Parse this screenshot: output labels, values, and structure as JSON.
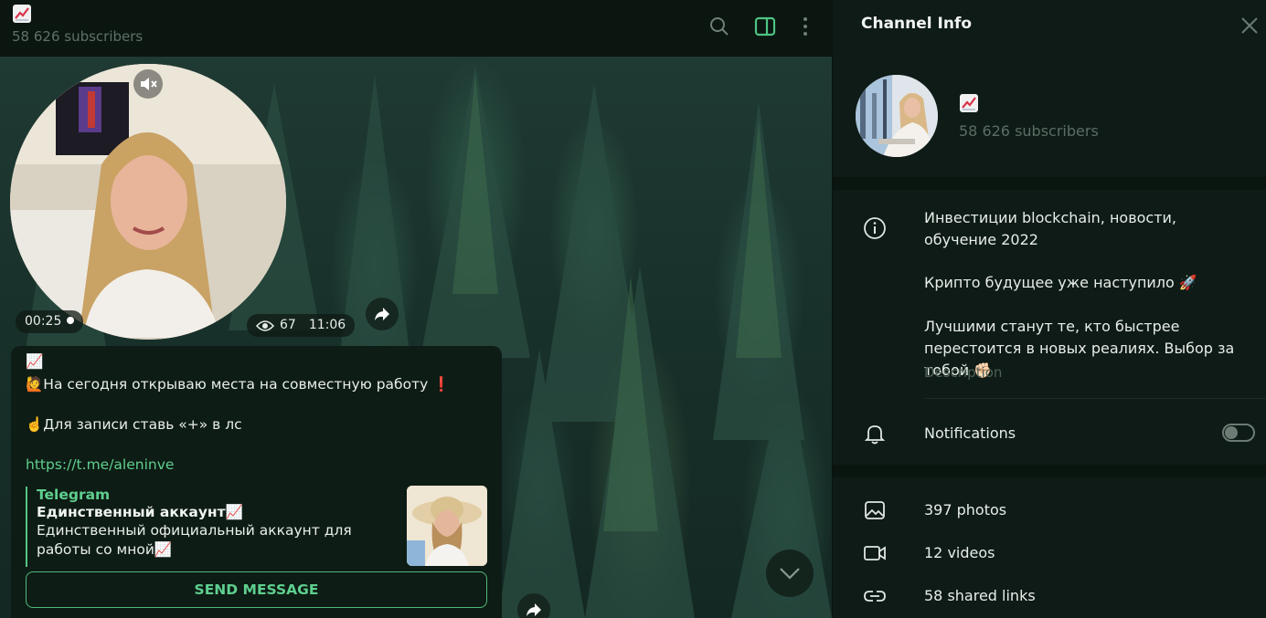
{
  "header": {
    "channel_emoji": "📈",
    "subscribers": "58 626 subscribers",
    "icons": [
      "search-icon",
      "sidebar-toggle-icon",
      "more-vertical-icon"
    ],
    "accent": "#4fc383"
  },
  "video_message": {
    "duration": "00:25",
    "views": "67",
    "time": "11:06"
  },
  "message": {
    "line1": "📈",
    "line2": "🙋На сегодня открываю  места на совместную работу ❗",
    "line3": "☝️Для записи ставь «+» в лс",
    "link": "https://t.me/aleninve",
    "preview": {
      "site": "Telegram",
      "title": "Единственный аккаунт📈",
      "description": "Единственный официальный аккаунт для работы со мной📈"
    },
    "button": "SEND MESSAGE"
  },
  "info_panel": {
    "title": "Channel Info",
    "channel_emoji": "📈",
    "subscribers": "58 626 subscribers",
    "about": {
      "line1": "Инвестиции blockchain, новости, обучение 2022",
      "line2": "Крипто будущее уже наступило 🚀",
      "line3": "Лучшими станут те, кто быстрее перестоится в новых реалиях. Выбор за тобой ✊🏻",
      "label": "Description"
    },
    "notifications": {
      "label": "Notifications",
      "enabled": false
    },
    "media": [
      {
        "label": "397 photos",
        "icon": "photo-icon"
      },
      {
        "label": "12 videos",
        "icon": "video-icon"
      },
      {
        "label": "58 shared links",
        "icon": "link-icon"
      }
    ]
  }
}
